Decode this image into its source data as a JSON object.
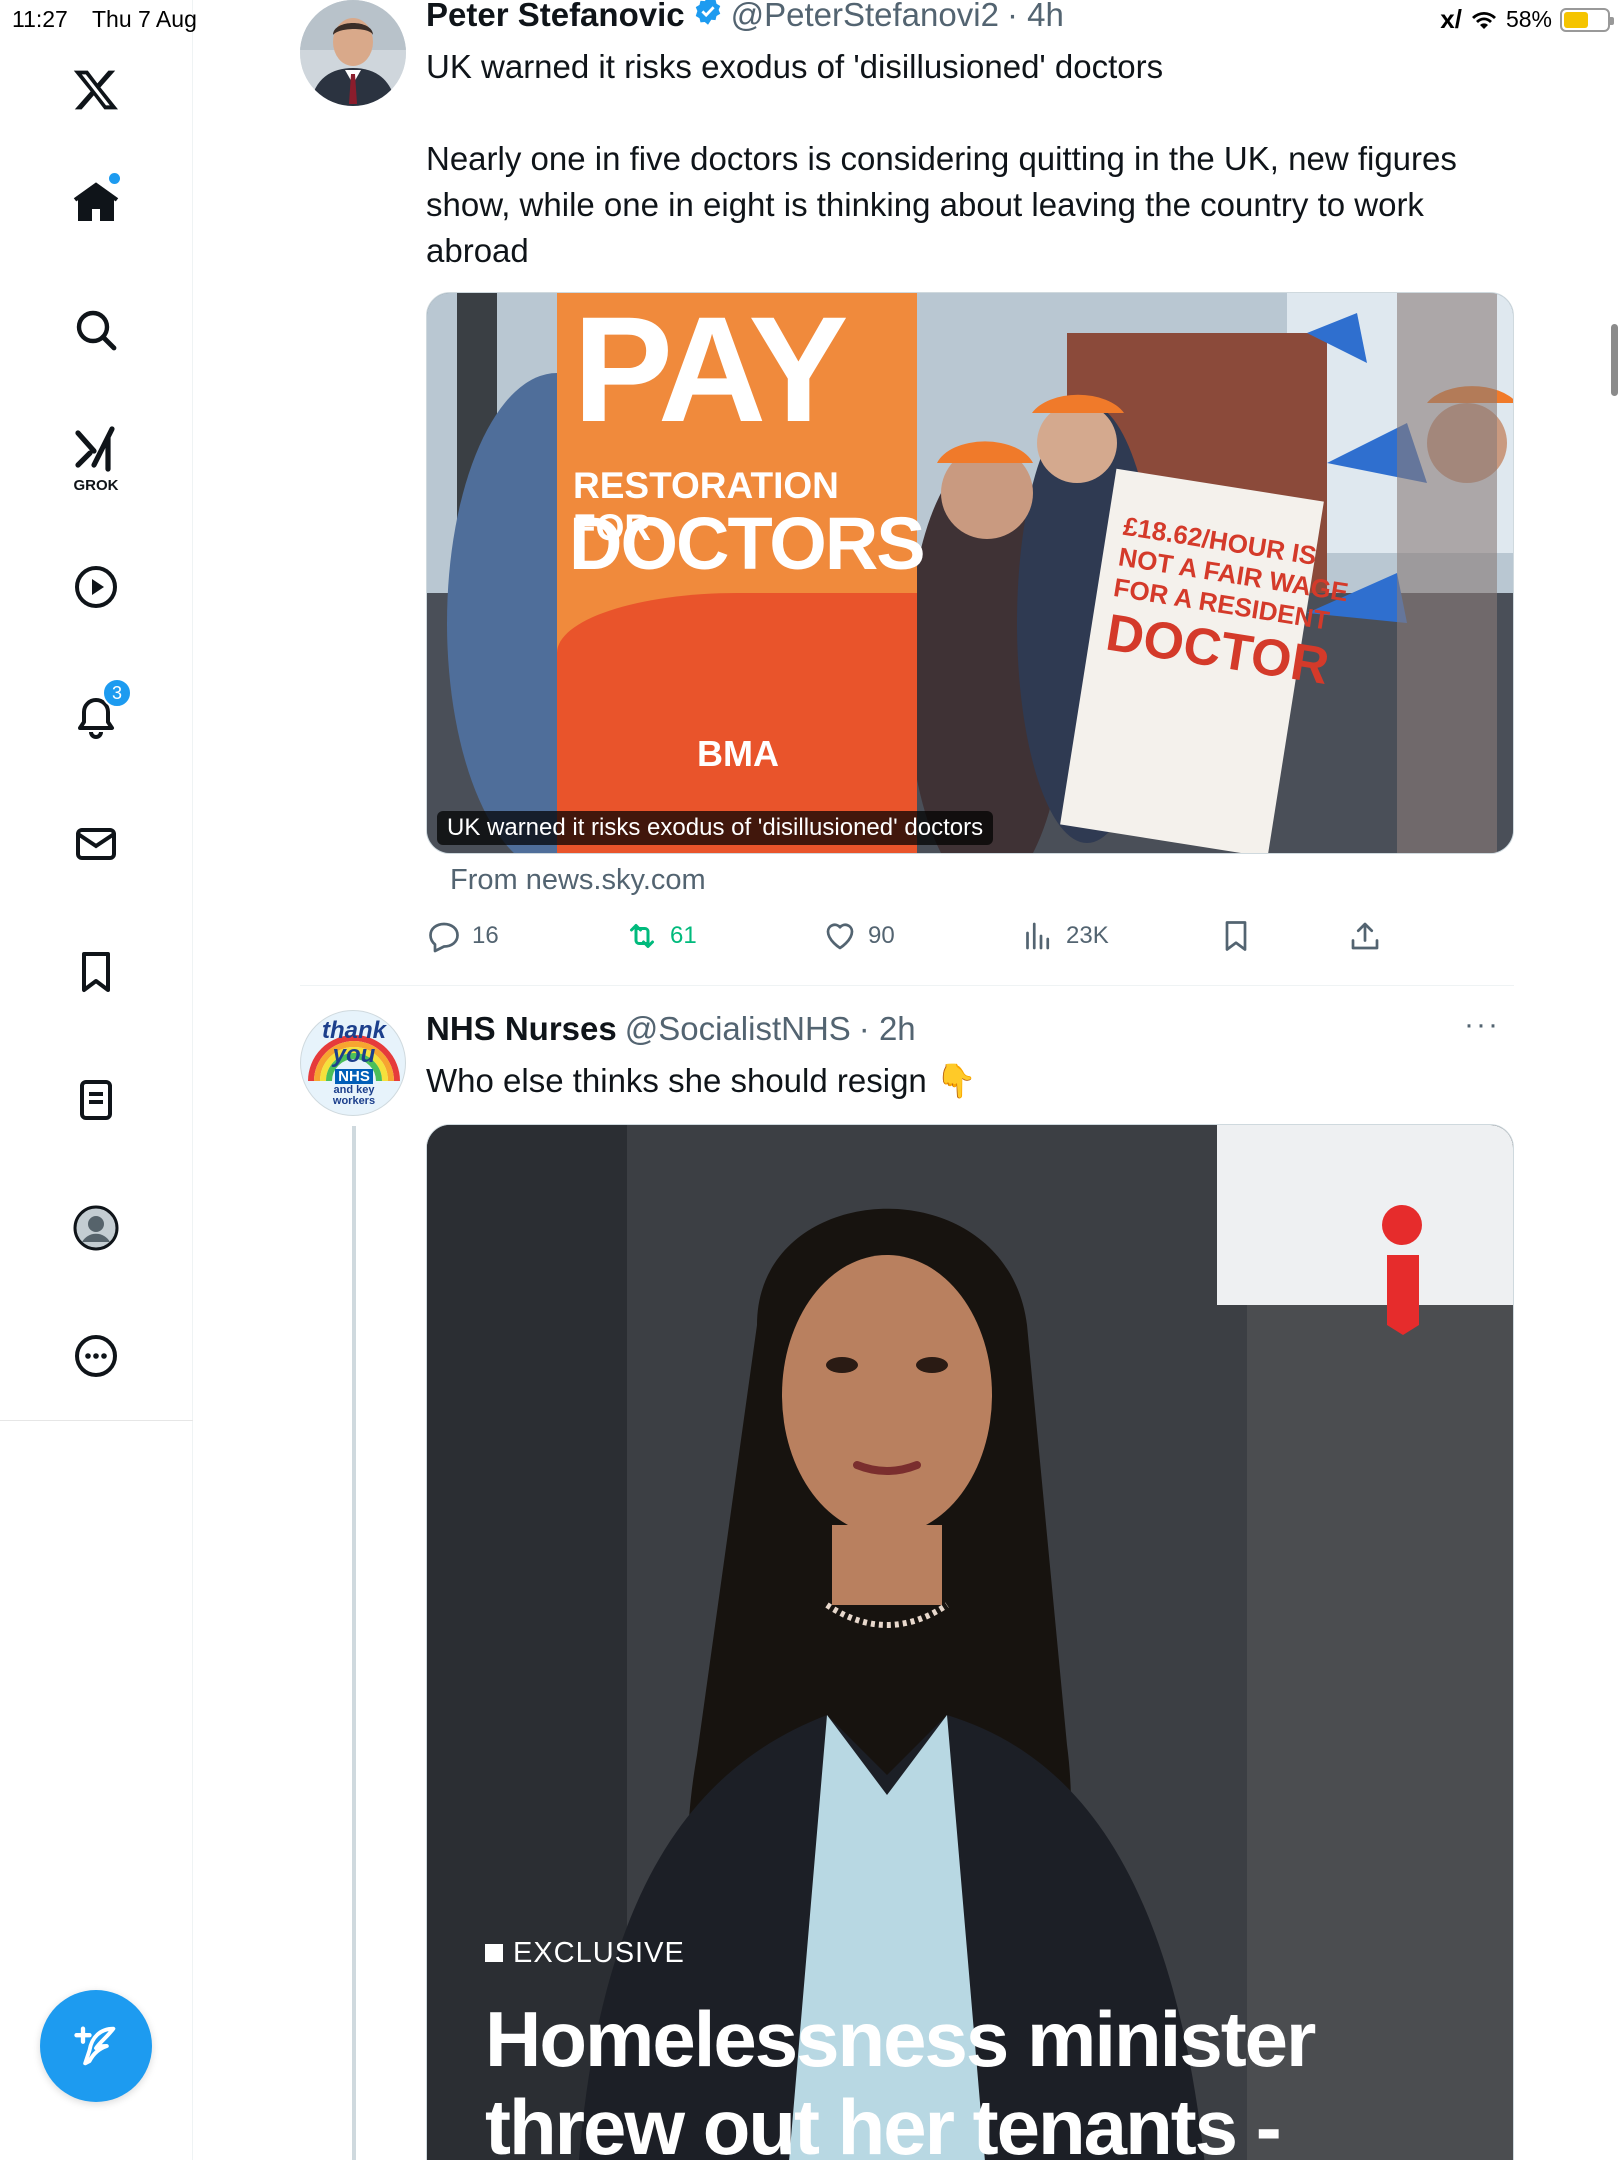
{
  "status_bar": {
    "time": "11:27",
    "date": "Thu 7 Aug",
    "battery": "58%",
    "battery_level": 0.58
  },
  "sidebar": {
    "items": [
      {
        "name": "x-logo",
        "label": ""
      },
      {
        "name": "home",
        "label": "",
        "has_dot": true
      },
      {
        "name": "search",
        "label": ""
      },
      {
        "name": "grok",
        "label": "GROK"
      },
      {
        "name": "videos",
        "label": ""
      },
      {
        "name": "notifications",
        "label": "",
        "badge": "3"
      },
      {
        "name": "messages",
        "label": ""
      },
      {
        "name": "bookmarks",
        "label": ""
      },
      {
        "name": "lists",
        "label": ""
      },
      {
        "name": "profile",
        "label": ""
      },
      {
        "name": "more",
        "label": ""
      }
    ],
    "accent": "#1d9bf0"
  },
  "tweets": [
    {
      "name": "Peter Stefanovic",
      "handle": "@PeterStefanovi2",
      "time": "· 4h",
      "verified": true,
      "text_line1": "UK warned it risks exodus of 'disillusioned' doctors",
      "text_body": "Nearly one in five doctors is considering quitting in the UK, new figures show, while one in eight is thinking about leaving the country to work abroad",
      "media": {
        "sign_big": "PAY",
        "sign_line1": "RESTORATION FOR",
        "sign_line2": "DOCTORS",
        "sign_logo": "BMA",
        "placard1": "£18.62/HOUR IS",
        "placard2": "NOT A FAIR WAGE",
        "placard3": "FOR A RESIDENT",
        "placard4": "DOCTOR",
        "caption": "UK warned it risks exodus of 'disillusioned' doctors"
      },
      "source": "From news.sky.com",
      "stats": {
        "replies": "16",
        "retweets": "61",
        "likes": "90",
        "views": "23K"
      }
    },
    {
      "name": "NHS Nurses",
      "handle": "@SocialistNHS",
      "time": "· 2h",
      "verified": false,
      "text_line1": "Who else thinks she should resign 👇",
      "avatar_text": [
        "thank",
        "you",
        "NHS",
        "and key",
        "workers"
      ],
      "media": {
        "tag": "EXCLUSIVE",
        "headline1": "Homelessness minister",
        "headline2": "threw out her tenants -"
      },
      "more": "···"
    }
  ]
}
